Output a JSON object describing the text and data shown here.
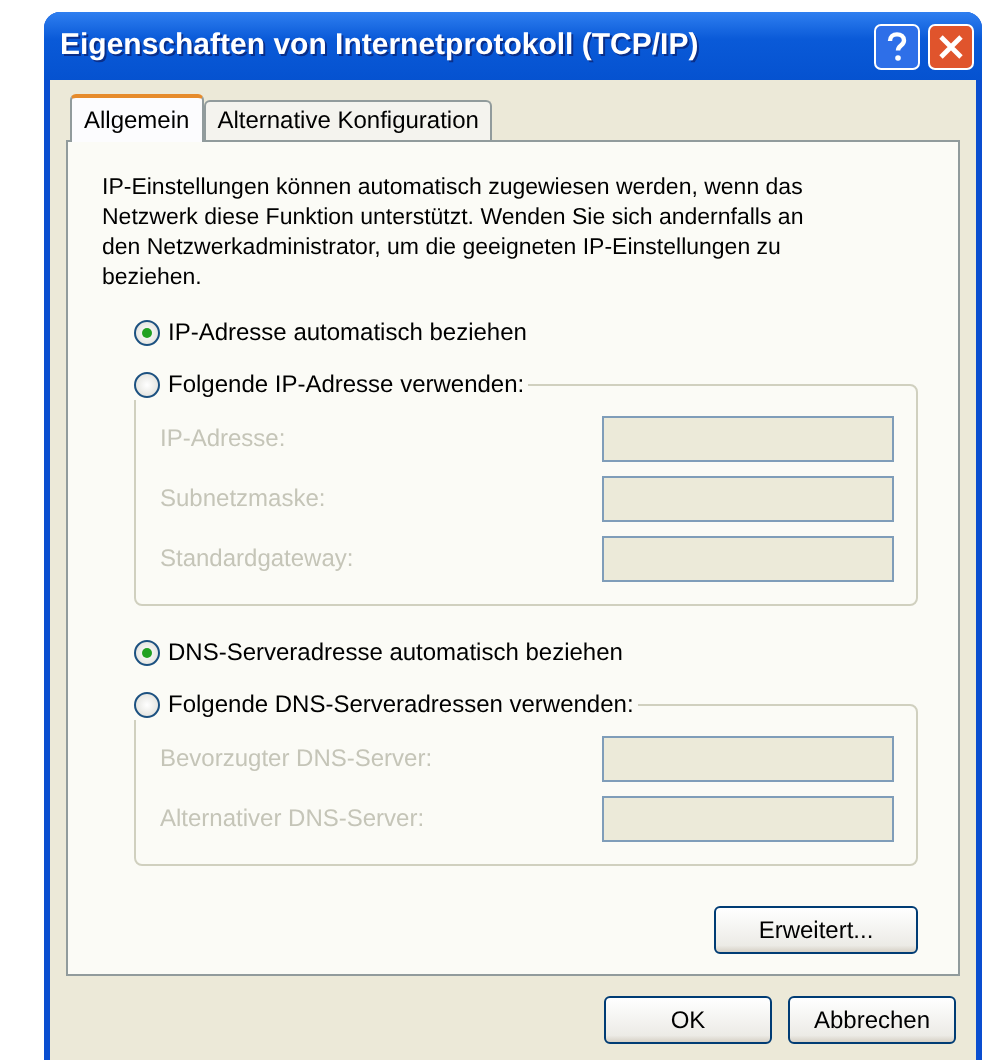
{
  "window": {
    "title": "Eigenschaften von Internetprotokoll (TCP/IP)"
  },
  "tabs": [
    {
      "label": "Allgemein",
      "selected": true
    },
    {
      "label": "Alternative Konfiguration",
      "selected": false
    }
  ],
  "description": "IP-Einstellungen können automatisch zugewiesen werden, wenn das Netzwerk diese Funktion unterstützt. Wenden Sie sich andernfalls an den Netzwerkadministrator, um die geeigneten IP-Einstellungen zu beziehen.",
  "sections": [
    {
      "auto_option": {
        "label": "IP-Adresse automatisch beziehen",
        "selected": true
      },
      "manual_option": {
        "label": "Folgende IP-Adresse verwenden:",
        "selected": false
      },
      "fields": [
        {
          "label": "IP-Adresse:",
          "disabled": true
        },
        {
          "label": "Subnetzmaske:",
          "disabled": true
        },
        {
          "label": "Standardgateway:",
          "disabled": true
        }
      ]
    },
    {
      "auto_option": {
        "label": "DNS-Serveradresse automatisch beziehen",
        "selected": true
      },
      "manual_option": {
        "label": "Folgende DNS-Serveradressen verwenden:",
        "selected": false
      },
      "fields": [
        {
          "label": "Bevorzugter DNS-Server:",
          "disabled": true
        },
        {
          "label": "Alternativer DNS-Server:",
          "disabled": true
        }
      ]
    }
  ],
  "advanced_button": "Erweitert...",
  "buttons": [
    "OK",
    "Abbrechen"
  ]
}
